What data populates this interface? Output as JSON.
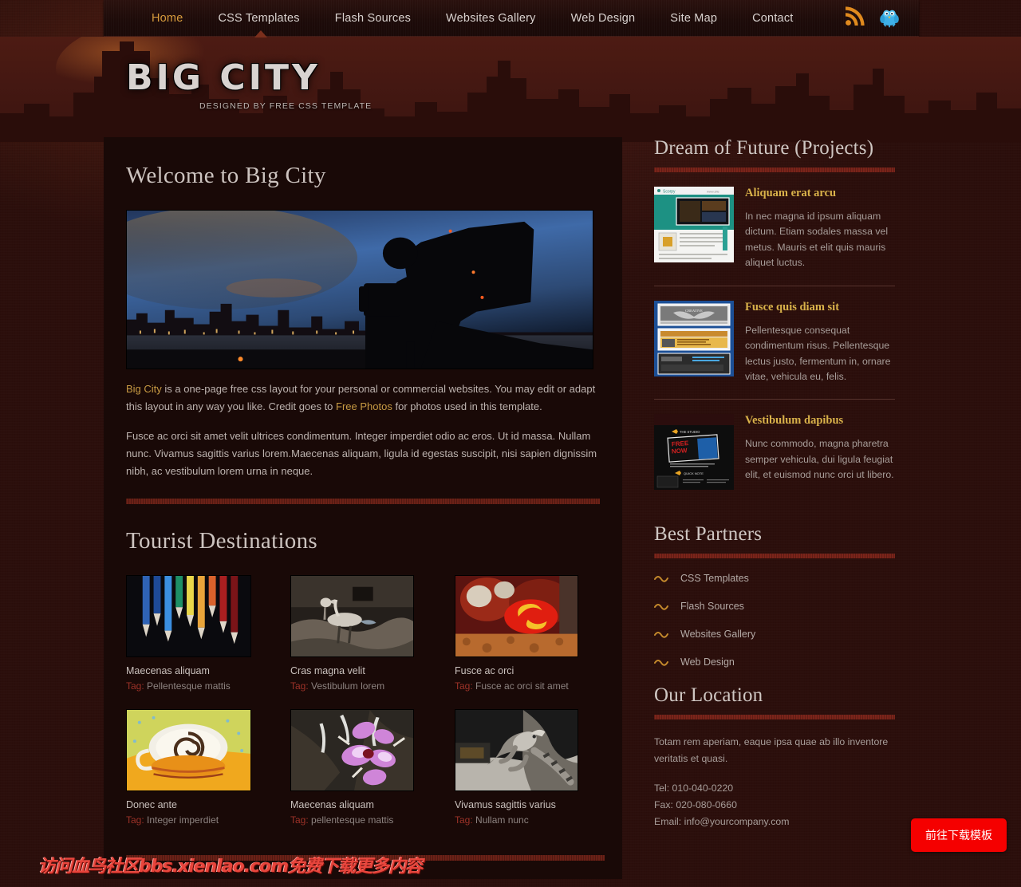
{
  "nav": {
    "items": [
      {
        "label": "Home",
        "active": true
      },
      {
        "label": "CSS Templates",
        "active": false
      },
      {
        "label": "Flash Sources",
        "active": false
      },
      {
        "label": "Websites Gallery",
        "active": false
      },
      {
        "label": "Web Design",
        "active": false
      },
      {
        "label": "Site Map",
        "active": false
      },
      {
        "label": "Contact",
        "active": false
      }
    ],
    "social": [
      {
        "name": "rss-icon",
        "color": "#e08a1e"
      },
      {
        "name": "twitter-bird-icon",
        "color": "#45b3e8"
      }
    ]
  },
  "header": {
    "logo": "BIG CITY",
    "tagline": "DESIGNED BY FREE CSS TEMPLATE"
  },
  "main": {
    "page_title": "Welcome to Big City",
    "banner_alt": "city skyline at dusk with film camera silhouette",
    "intro_p1_pre": "",
    "intro_link1": "Big City",
    "intro_p1_mid": " is a one-page free css layout for your personal or commercial websites. You may edit or adapt this layout in any way you like. Credit goes to ",
    "intro_link2": "Free Photos",
    "intro_p1_end": " for photos used in this template.",
    "intro_p2": "Fusce ac orci sit amet velit ultrices condimentum. Integer imperdiet odio ac eros. Ut id massa. Nullam nunc. Vivamus sagittis varius lorem.Maecenas aliquam, ligula id egestas suscipit, nisi sapien dignissim nibh, ac vestibulum lorem urna in neque.",
    "gallery_title": "Tourist Destinations",
    "tag_label": "Tag:",
    "gallery": [
      {
        "title": "Maecenas aliquam",
        "tag": "Pellentesque mattis",
        "image": "colored-pencils"
      },
      {
        "title": "Cras magna velit",
        "tag": "Vestibulum lorem",
        "image": "cranes-birds"
      },
      {
        "title": "Fusce ac orci",
        "tag": "Fusce ac orci sit amet",
        "image": "red-fire-abstract"
      },
      {
        "title": "Donec ante",
        "tag": "Integer imperdiet",
        "image": "coffee-cup-swirl"
      },
      {
        "title": "Maecenas aliquam",
        "tag": "pellentesque mattis",
        "image": "purple-orchids"
      },
      {
        "title": "Vivamus sagittis varius",
        "tag": "Nullam nunc",
        "image": "lizard-iguana"
      }
    ]
  },
  "sidebar": {
    "projects_title": "Dream of Future (Projects)",
    "projects": [
      {
        "title": "Aliquam erat arcu",
        "desc": "In nec magna id ipsum aliquam dictum. Etiam sodales massa vel metus. Mauris et elit quis mauris aliquet luctus.",
        "image": "teal-website-screenshot"
      },
      {
        "title": "Fusce quis diam sit",
        "desc": "Pellentesque consequat condimentum risus. Pellentesque lectus justo, fermentum in, ornare vitae, vehicula eu, felis.",
        "image": "blue-template-previews"
      },
      {
        "title": "Vestibulum dapibus",
        "desc": "Nunc commodo, magna pharetra semper vehicula, dui ligula feugiat elit, et euismod nunc orci ut libero.",
        "image": "dark-studio-website"
      }
    ],
    "partners_title": "Best Partners",
    "partners": [
      {
        "label": "CSS Templates"
      },
      {
        "label": "Flash Sources"
      },
      {
        "label": "Websites Gallery"
      },
      {
        "label": "Web Design"
      }
    ],
    "location_title": "Our Location",
    "location_text": "Totam rem aperiam, eaque ipsa quae ab illo inventore veritatis et quasi.",
    "tel": "Tel: 010-040-0220",
    "fax": "Fax: 020-080-0660",
    "email": "Email: info@yourcompany.com"
  },
  "overlay": {
    "download_button": "前往下载模板",
    "watermark": "访问血鸟社区bbs.xienlao.com免费下载更多内容"
  },
  "colors": {
    "accent_gold": "#d9b24a",
    "accent_red": "#7a241a",
    "content_bg": "#190907",
    "body_bg": "#2e0f0c"
  }
}
